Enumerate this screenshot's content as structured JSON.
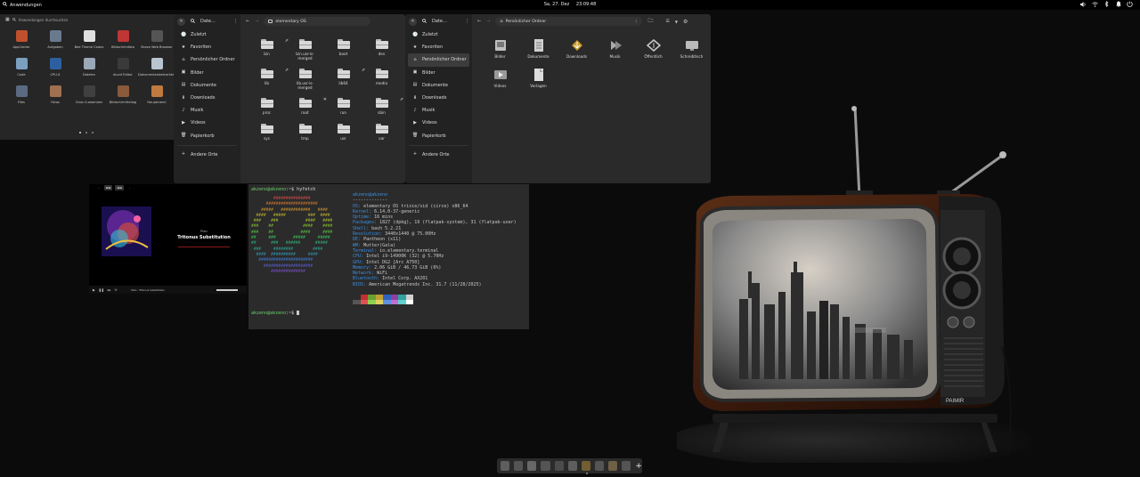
{
  "panel": {
    "apps_label": "Anwendungen",
    "date": "Sa, 27. Dez",
    "time": "23:09:48"
  },
  "launcher": {
    "search_placeholder": "Anwendungen durchsuchen",
    "apps": [
      {
        "label": "AppCenter",
        "color": "#c0502d"
      },
      {
        "label": "Aufgaben",
        "color": "#6a7a8e"
      },
      {
        "label": "Bee Theme Colors",
        "color": "#e0e0e0"
      },
      {
        "label": "Bildschirmfoto",
        "color": "#c03535"
      },
      {
        "label": "Brave Web Browser",
        "color": "#555"
      },
      {
        "label": "Code",
        "color": "#7aa0c0"
      },
      {
        "label": "CPU-X",
        "color": "#2d5fa0"
      },
      {
        "label": "Dateien",
        "color": "#9aa8b8"
      },
      {
        "label": "dconf Editor",
        "color": "#3a3a3a"
      },
      {
        "label": "Dokumentenbetrachter",
        "color": "#b8c4d0"
      },
      {
        "label": "Files",
        "color": "#5a6a80"
      },
      {
        "label": "Fotos",
        "color": "#a07050"
      },
      {
        "label": "Grub Customizer",
        "color": "#404040"
      },
      {
        "label": "Bildschirmfreilog",
        "color": "#8a5a3a"
      },
      {
        "label": "Hauptmenü",
        "color": "#c07a40"
      }
    ]
  },
  "files1": {
    "title": "Date…",
    "path": "elementary OS",
    "sidebar": [
      "Zuletzt",
      "Favoriten",
      "Persönlicher Ordner",
      "Bilder",
      "Dokumente",
      "Downloads",
      "Musik",
      "Videos",
      "Papierkorb",
      "Andere Orte"
    ],
    "folders": [
      {
        "label": "bin",
        "badge": "link"
      },
      {
        "label": "bin.usr-is-\nmerged",
        "badge": ""
      },
      {
        "label": "boot",
        "badge": ""
      },
      {
        "label": "dev",
        "badge": ""
      },
      {
        "label": "lib",
        "badge": "link"
      },
      {
        "label": "lib.usr-is-\nmerged",
        "badge": ""
      },
      {
        "label": "lib64",
        "badge": "link"
      },
      {
        "label": "media",
        "badge": ""
      },
      {
        "label": "proc",
        "badge": ""
      },
      {
        "label": "root",
        "badge": "x"
      },
      {
        "label": "run",
        "badge": ""
      },
      {
        "label": "sbin",
        "badge": "link"
      },
      {
        "label": "sys",
        "badge": ""
      },
      {
        "label": "tmp",
        "badge": ""
      },
      {
        "label": "usr",
        "badge": ""
      },
      {
        "label": "var",
        "badge": ""
      }
    ]
  },
  "files2": {
    "title": "Date…",
    "path": "Persönlicher Ordner",
    "sidebar": [
      "Zuletzt",
      "Favoriten",
      "Persönlicher Ordner",
      "Bilder",
      "Dokumente",
      "Downloads",
      "Musik",
      "Videos",
      "Papierkorb",
      "Andere Orte"
    ],
    "folders": [
      {
        "label": "Bilder"
      },
      {
        "label": "Dokumente"
      },
      {
        "label": "Downloads"
      },
      {
        "label": "Musik"
      },
      {
        "label": "Öffentlich"
      },
      {
        "label": "Schreibtisch"
      },
      {
        "label": "Videos"
      },
      {
        "label": "Vorlagen"
      }
    ]
  },
  "music": {
    "artist": "Plan",
    "title": "Tritonus Substitution",
    "now_playing": "Plan - Tritonus Substitution"
  },
  "terminal": {
    "prompt_user": "akzeno@akzeno",
    "prompt_cmd": ":~$ hyfetch",
    "host_header": "akzeno@akzeno",
    "separator": "-------------",
    "info": [
      {
        "k": "OS",
        "v": "elementary OS trixie/sid (circe) x86_64"
      },
      {
        "k": "Kernel",
        "v": "6.14.0-37-generic"
      },
      {
        "k": "Uptime",
        "v": "16 mins"
      },
      {
        "k": "Packages",
        "v": "1827 (dpkg), 19 (flatpak-system), 31 (flatpak-user)"
      },
      {
        "k": "Shell",
        "v": "bash 5.2.21"
      },
      {
        "k": "Resolution",
        "v": "3440x1440 @ 75.00Hz"
      },
      {
        "k": "DE",
        "v": "Pantheon (x11)"
      },
      {
        "k": "WM",
        "v": "Mutter(Gala)"
      },
      {
        "k": "Terminal",
        "v": "io.elementary.terminal"
      },
      {
        "k": "CPU",
        "v": "Intel i9-14900K (32) @ 5.70Hz"
      },
      {
        "k": "GPU",
        "v": "Intel DG2 [Arc A750]"
      },
      {
        "k": "Memory",
        "v": "2.06 GiB / 46.73 GiB (6%)"
      },
      {
        "k": "Network",
        "v": "WiFi"
      },
      {
        "k": "Bluetooth",
        "v": "Intel Corp. AX201"
      },
      {
        "k": "BIOS",
        "v": "American Megatrends Inc. 31.7 (11/28/2025)"
      }
    ],
    "prompt2_cmd": ":~$ ",
    "swatch_colors": [
      "#2b2b2b",
      "#c03030",
      "#6aa030",
      "#c0a030",
      "#3060c0",
      "#9040a0",
      "#30a0a0",
      "#d0d0d0",
      "#555",
      "#e05050",
      "#90d050",
      "#e0d060",
      "#6090e0",
      "#c070d0",
      "#60d0d0",
      "#ffffff"
    ]
  },
  "dock": {
    "colors": [
      "#888",
      "#777",
      "#999",
      "#777",
      "#666",
      "#888",
      "#b08a3a",
      "#777",
      "#a88a5a",
      "#777"
    ]
  }
}
